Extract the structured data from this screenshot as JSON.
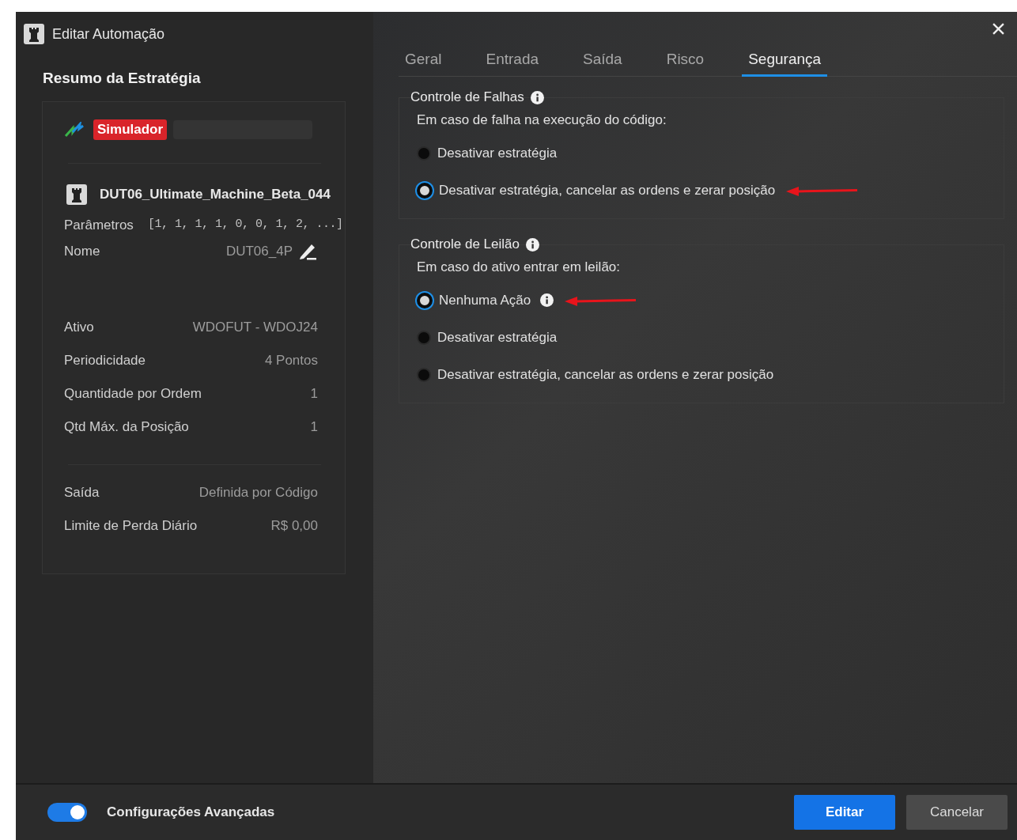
{
  "window": {
    "title": "Editar Automação"
  },
  "summary": {
    "title": "Resumo da Estratégia",
    "mode_badge": "Simulador",
    "strategy_name": "DUT06_Ultimate_Machine_Beta_044",
    "parameters": {
      "label": "Parâmetros",
      "value": "[1, 1, 1, 1, 0, 0, 1, 2, ...]"
    },
    "name": {
      "label": "Nome",
      "value": "DUT06_4P"
    },
    "groups": [
      [
        {
          "label": "Ativo",
          "value": "WDOFUT - WDOJ24"
        },
        {
          "label": "Periodicidade",
          "value": "4 Pontos"
        },
        {
          "label": "Quantidade por Ordem",
          "value": "1"
        },
        {
          "label": "Qtd Máx. da Posição",
          "value": "1"
        }
      ],
      [
        {
          "label": "Saída",
          "value": "Definida por Código"
        },
        {
          "label": "Limite de Perda Diário",
          "value": "R$ 0,00"
        }
      ]
    ]
  },
  "tabs": [
    {
      "label": "Geral",
      "selected": false
    },
    {
      "label": "Entrada",
      "selected": false
    },
    {
      "label": "Saída",
      "selected": false
    },
    {
      "label": "Risco",
      "selected": false
    },
    {
      "label": "Segurança",
      "selected": true
    }
  ],
  "sections": [
    {
      "title": "Controle de Falhas",
      "prompt": "Em caso de falha na execução do código:",
      "options": [
        {
          "label": "Desativar estratégia",
          "selected": false,
          "info": false,
          "annotated": false
        },
        {
          "label": "Desativar estratégia, cancelar as ordens e zerar posição",
          "selected": true,
          "info": false,
          "annotated": true
        }
      ]
    },
    {
      "title": "Controle de Leilão",
      "prompt": "Em caso do ativo entrar em leilão:",
      "options": [
        {
          "label": "Nenhuma Ação",
          "selected": true,
          "info": true,
          "annotated": true
        },
        {
          "label": "Desativar estratégia",
          "selected": false,
          "info": false,
          "annotated": false
        },
        {
          "label": "Desativar estratégia, cancelar as ordens e zerar posição",
          "selected": false,
          "info": false,
          "annotated": false
        }
      ]
    }
  ],
  "footer": {
    "advanced_toggle": {
      "label": "Configurações Avançadas",
      "on": true
    },
    "buttons": [
      {
        "label": "Editar",
        "kind": "primary"
      },
      {
        "label": "Cancelar",
        "kind": "secondary"
      }
    ]
  }
}
